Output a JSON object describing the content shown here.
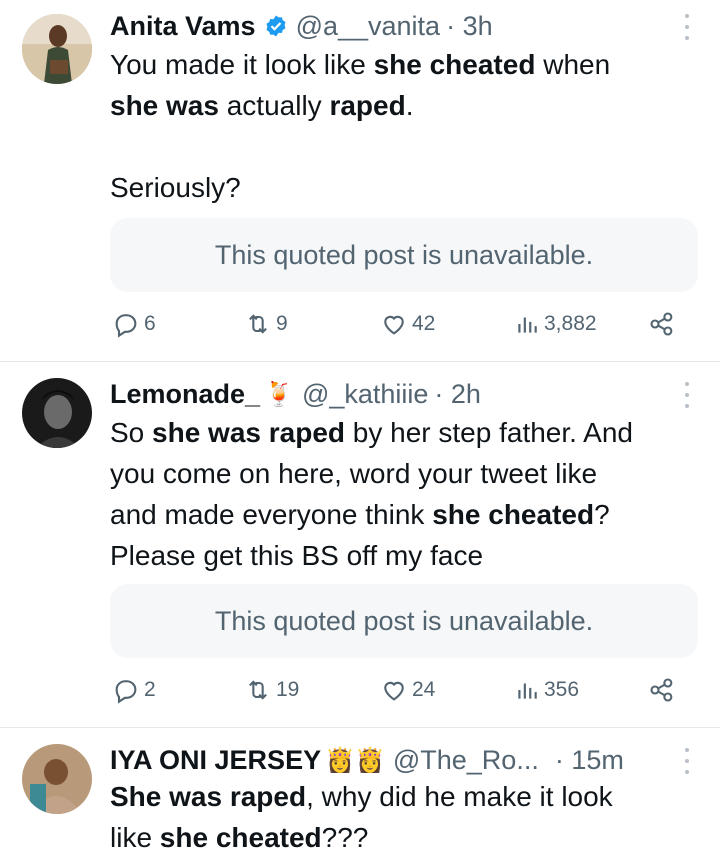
{
  "tweets": [
    {
      "name": "Anita Vams",
      "handle": "@a__vanita",
      "time": "· 3h",
      "verified": true,
      "body_lines": [
        [
          {
            "t": "You made it look like ",
            "b": false
          },
          {
            "t": "she cheated",
            "b": true
          },
          {
            "t": " when",
            "b": false
          }
        ],
        [
          {
            "t": "she was",
            "b": true
          },
          {
            "t": " actually ",
            "b": false
          },
          {
            "t": "raped",
            "b": true
          },
          {
            "t": ".",
            "b": false
          }
        ],
        [],
        [
          {
            "t": "Seriously?",
            "b": false
          }
        ]
      ],
      "quote": "This quoted post is unavailable.",
      "replies": "6",
      "reposts": "9",
      "likes": "42",
      "views": "3,882"
    },
    {
      "name": "Lemonade_",
      "name_emoji": "🍹",
      "handle": "@_kathiiie",
      "time": "· 2h",
      "body_lines": [
        [
          {
            "t": "So ",
            "b": false
          },
          {
            "t": "she was raped",
            "b": true
          },
          {
            "t": " by her step father. And",
            "b": false
          }
        ],
        [
          {
            "t": "you come on here, word your tweet like",
            "b": false
          }
        ],
        [
          {
            "t": "and made everyone think ",
            "b": false
          },
          {
            "t": "she cheated",
            "b": true
          },
          {
            "t": "?",
            "b": false
          }
        ],
        [
          {
            "t": "Please get this BS off my face",
            "b": false
          }
        ]
      ],
      "quote": "This quoted post is unavailable.",
      "replies": "2",
      "reposts": "19",
      "likes": "24",
      "views": "356"
    },
    {
      "name": "IYA ONI JERSEY",
      "name_emoji": "👸👸",
      "handle": "@The_Ro...",
      "time": "· 15m",
      "body_lines": [
        [
          {
            "t": "She was raped",
            "b": true
          },
          {
            "t": ", why did he make it look",
            "b": false
          }
        ],
        [
          {
            "t": "like ",
            "b": false
          },
          {
            "t": "she cheated",
            "b": true
          },
          {
            "t": "???",
            "b": false
          }
        ]
      ]
    }
  ],
  "colors": {
    "verified": "#1d9bf0",
    "muted": "#536471",
    "text": "#0f1419"
  }
}
